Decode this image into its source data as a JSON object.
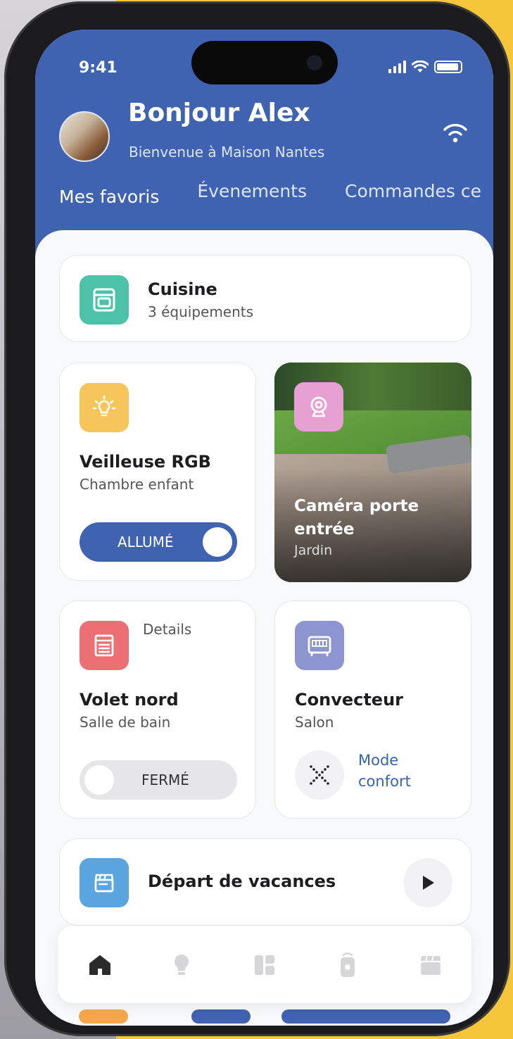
{
  "status": {
    "time": "9:41"
  },
  "header": {
    "greeting": "Bonjour Alex",
    "welcome": "Bienvenue à Maison Nantes",
    "tabs": [
      "Mes favoris",
      "Évenements",
      "Commandes ce"
    ]
  },
  "cards": {
    "kitchen": {
      "title": "Cuisine",
      "subtitle": "3 équipements",
      "icon": "oven-icon"
    },
    "light": {
      "title": "Veilleuse RGB",
      "subtitle": "Chambre enfant",
      "toggle_label": "ALLUMÉ",
      "on": true,
      "icon": "bulb-icon"
    },
    "camera": {
      "title": "Caméra porte entrée",
      "subtitle": "Jardin",
      "icon": "webcam-icon"
    },
    "shutter": {
      "title": "Volet nord",
      "subtitle": "Salle de bain",
      "details": "Details",
      "toggle_label": "FERMÉ",
      "on": false,
      "icon": "shutter-icon"
    },
    "heater": {
      "title": "Convecteur",
      "subtitle": "Salon",
      "mode_line1": "Mode",
      "mode_line2": "confort",
      "icon": "heater-icon"
    },
    "scene": {
      "title": "Départ de vacances",
      "icon": "clapper-icon"
    }
  },
  "tabbar": [
    "home-icon",
    "bulb-icon",
    "dashboard-icon",
    "remote-icon",
    "clapper-icon"
  ],
  "colors": {
    "primary": "#3f63b0",
    "teal": "#4cc3a8",
    "yellow": "#f7c65a",
    "pink": "#e7a0d2",
    "red": "#ec6f74",
    "lavender": "#8c95cf",
    "sky": "#5aa4e0",
    "link": "#3563b5"
  }
}
